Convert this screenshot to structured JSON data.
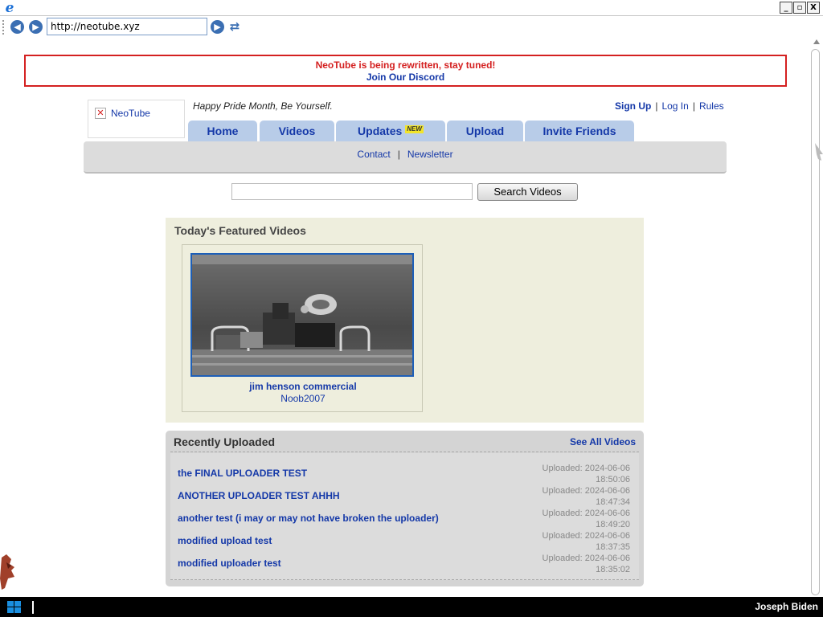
{
  "browser": {
    "address": "http://neotube.xyz",
    "window_buttons": [
      "_",
      "▫",
      "X"
    ]
  },
  "banner": {
    "title": "NeoTube is being rewritten, stay tuned!",
    "link": "Join Our Discord"
  },
  "header": {
    "logo_alt": "NeoTube",
    "tagline": "Happy Pride Month, Be Yourself.",
    "user_links": [
      "Sign Up",
      "Log In",
      "Rules"
    ]
  },
  "tabs": [
    {
      "label": "Home"
    },
    {
      "label": "Videos"
    },
    {
      "label": "Updates",
      "badge": "NEW"
    },
    {
      "label": "Upload"
    },
    {
      "label": "Invite Friends"
    }
  ],
  "subnav": [
    "Contact",
    "Newsletter"
  ],
  "search": {
    "value": "",
    "button_label": "Search Videos"
  },
  "featured": {
    "title": "Today's Featured Videos",
    "video": {
      "title": "jim henson commercial",
      "author": "Noob2007"
    }
  },
  "recent": {
    "title": "Recently Uploaded",
    "see_all": "See All Videos",
    "items": [
      {
        "title": "the FINAL UPLOADER TEST",
        "date": "Uploaded: 2024-06-06",
        "time": "18:50:06"
      },
      {
        "title": "ANOTHER UPLOADER TEST AHHH",
        "date": "Uploaded: 2024-06-06",
        "time": "18:47:34"
      },
      {
        "title": "another test (i may or may not have broken the uploader)",
        "date": "Uploaded: 2024-06-06",
        "time": "18:49:20"
      },
      {
        "title": "modified upload test",
        "date": "Uploaded: 2024-06-06",
        "time": "18:37:35"
      },
      {
        "title": "modified uploader test",
        "date": "Uploaded: 2024-06-06",
        "time": "18:35:02"
      }
    ]
  },
  "taskbar": {
    "user": "Joseph Biden"
  },
  "colors": {
    "link": "#1438a8",
    "banner_red": "#d42020",
    "tab_bg": "#b8cce8",
    "featured_bg": "#eeeedd",
    "recent_bg": "#d4d4d4"
  }
}
